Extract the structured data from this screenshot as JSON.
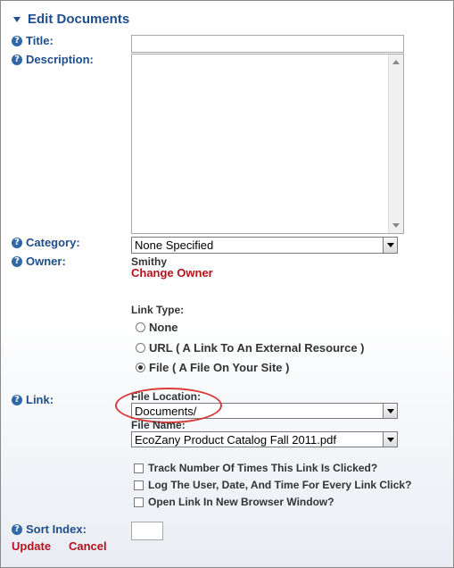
{
  "header": {
    "title": "Edit Documents"
  },
  "fields": {
    "title": {
      "label": "Title:",
      "value": ""
    },
    "description": {
      "label": "Description:",
      "value": ""
    },
    "category": {
      "label": "Category:",
      "selected": "None Specified"
    },
    "owner": {
      "label": "Owner:",
      "name": "Smithy",
      "change_link": "Change Owner"
    },
    "link_type": {
      "label": "Link Type:",
      "options": [
        {
          "label": "None",
          "selected": false
        },
        {
          "label": "URL ( A Link To An External Resource )",
          "selected": false
        },
        {
          "label": "File ( A File On Your Site )",
          "selected": true
        }
      ]
    },
    "link": {
      "label": "Link:",
      "file_location_label": "File Location:",
      "file_location_value": "Documents/",
      "file_name_label": "File Name:",
      "file_name_value": "EcoZany Product Catalog Fall 2011.pdf"
    },
    "checkboxes": [
      {
        "label": "Track Number Of Times This Link Is Clicked?",
        "checked": false
      },
      {
        "label": "Log The User, Date, And Time For Every Link Click?",
        "checked": false
      },
      {
        "label": "Open Link In New Browser Window?",
        "checked": false
      }
    ],
    "sort_index": {
      "label": "Sort Index:",
      "value": ""
    }
  },
  "actions": {
    "update": "Update",
    "cancel": "Cancel"
  },
  "icons": {
    "help": "help-icon",
    "collapse": "triangle-down-icon"
  },
  "colors": {
    "label": "#1f4e8c",
    "action": "#b5121b",
    "highlight": "#d83a3a"
  }
}
